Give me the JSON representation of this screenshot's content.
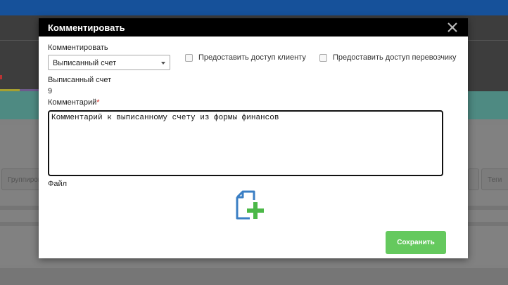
{
  "background": {
    "group_button_label": "Группировать",
    "tags_button_label": "Теги"
  },
  "modal": {
    "title": "Комментировать",
    "comment_on_label": "Комментировать",
    "comment_on_selected": "Выписанный счет",
    "share_client_label": "Предоставить доступ клиенту",
    "share_carrier_label": "Предоставить доступ перевозчику",
    "invoice_label": "Выписанный счет",
    "invoice_value": "9",
    "comment_label": "Комментарий",
    "required_mark": "*",
    "comment_text": "Комментарий к выписанному счету из формы финансов",
    "file_label": "Файл",
    "save_label": "Сохранить"
  },
  "icons": {
    "close": "close-icon",
    "file_add": "file-add-icon",
    "dropdown": "chevron-down-icon"
  },
  "colors": {
    "topbar": "#16519a",
    "modal_header": "#000000",
    "save_button": "#65c95e",
    "required": "#d9342b",
    "file_icon_blue": "#3b7fc4",
    "file_icon_green": "#4cb848"
  }
}
